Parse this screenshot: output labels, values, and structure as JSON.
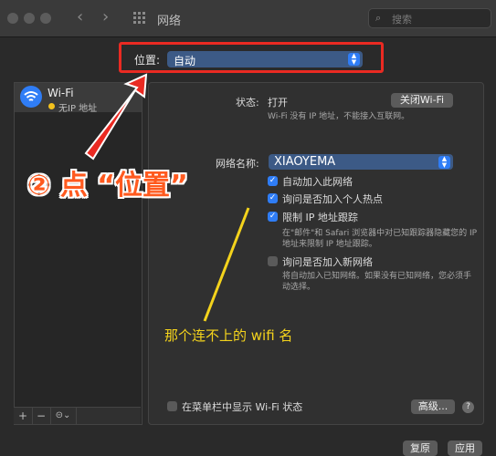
{
  "window": {
    "title": "网络"
  },
  "search": {
    "placeholder": "搜索"
  },
  "location": {
    "label": "位置:",
    "value": "自动"
  },
  "services": [
    {
      "name": "Wi-Fi",
      "status": "无IP 地址"
    }
  ],
  "left_toolbar": {
    "add": "+",
    "remove": "−",
    "action": "⊝⌄"
  },
  "detail": {
    "status_label": "状态:",
    "status_value": "打开",
    "toggle_wifi_button": "关闭Wi-Fi",
    "status_desc": "Wi-Fi 没有 IP 地址，不能接入互联网。",
    "network_name_label": "网络名称:",
    "network_name_value": "XIAOYEMA",
    "options": [
      {
        "label": "自动加入此网络",
        "checked": true
      },
      {
        "label": "询问是否加入个人热点",
        "checked": true
      },
      {
        "label": "限制 IP 地址跟踪",
        "checked": true
      }
    ],
    "limit_ip_desc_1": "在\"邮件\"和 Safari 浏览器中对已知跟踪器隐藏您的 IP",
    "limit_ip_desc_2": "地址来限制 IP 地址跟踪。",
    "ask_new_label": "询问是否加入新网络",
    "ask_new_checked": false,
    "ask_new_desc_1": "将自动加入已知网络。如果没有已知网络，您必须手",
    "ask_new_desc_2": "动选择。",
    "menubar_label": "在菜单栏中显示 Wi-Fi 状态",
    "menubar_checked": false,
    "advanced_button": "高级...",
    "help_button": "?"
  },
  "footer": {
    "revert_button": "复原",
    "apply_button": "应用"
  },
  "annotations": {
    "step": "② 点 “位置”",
    "wifi_note": "那个连不上的 wifi 名"
  },
  "colors": {
    "accent": "#2f7df6",
    "annotation_red": "#ea2a22",
    "annotation_yellow": "#f4d31c"
  }
}
